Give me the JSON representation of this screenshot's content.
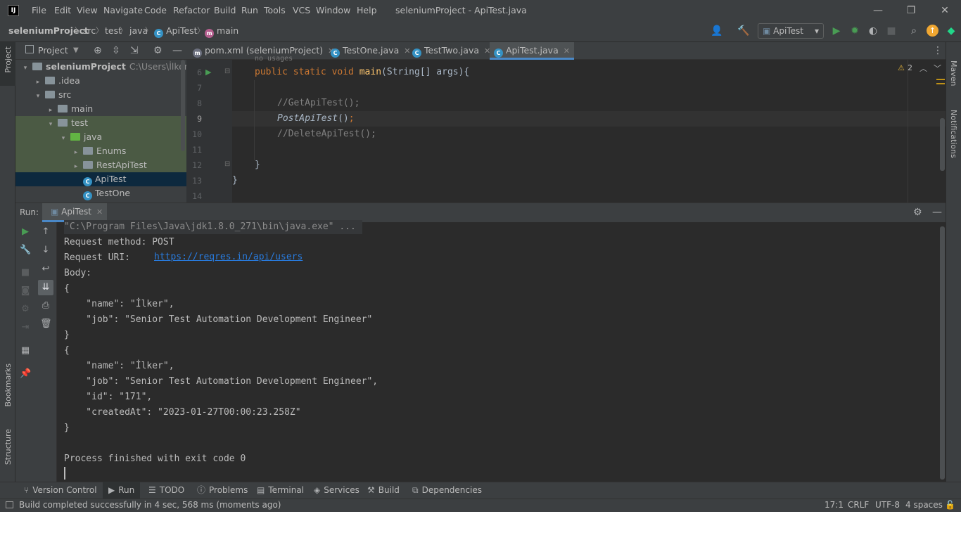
{
  "window": {
    "logo": "IJ",
    "title": "seleniumProject - ApiTest.java",
    "menu": [
      "File",
      "Edit",
      "View",
      "Navigate",
      "Code",
      "Refactor",
      "Build",
      "Run",
      "Tools",
      "VCS",
      "Window",
      "Help"
    ],
    "minimize": "—",
    "restore": "❐",
    "close": "✕"
  },
  "breadcrumb": {
    "project": "seleniumProject",
    "items": [
      "src",
      "test",
      "java"
    ],
    "class": "ApiTest",
    "method": "main"
  },
  "toolbar": {
    "run_config": "ApiTest"
  },
  "left_strip": {
    "project": "Project",
    "bookmarks": "Bookmarks",
    "structure": "Structure"
  },
  "right_strip": {
    "maven": "Maven",
    "notifications": "Notifications"
  },
  "project_panel": {
    "title": "Project",
    "tree": [
      {
        "label": "seleniumProject",
        "path": "C:\\Users\\İlker ESEN\\",
        "indent": 0,
        "arrow": "▾",
        "icon": "folder"
      },
      {
        "label": ".idea",
        "indent": 1,
        "arrow": "▸",
        "icon": "folder"
      },
      {
        "label": "src",
        "indent": 1,
        "arrow": "▾",
        "icon": "folder"
      },
      {
        "label": "main",
        "indent": 2,
        "arrow": "▸",
        "icon": "folder"
      },
      {
        "label": "test",
        "indent": 2,
        "arrow": "▾",
        "icon": "folder"
      },
      {
        "label": "java",
        "indent": 3,
        "arrow": "▾",
        "icon": "green-folder"
      },
      {
        "label": "Enums",
        "indent": 4,
        "arrow": "▸",
        "icon": "package"
      },
      {
        "label": "RestApiTest",
        "indent": 4,
        "arrow": "▸",
        "icon": "package"
      },
      {
        "label": "ApiTest",
        "indent": 4,
        "arrow": "",
        "icon": "class"
      },
      {
        "label": "TestOne",
        "indent": 4,
        "arrow": "",
        "icon": "class"
      }
    ]
  },
  "editor": {
    "tabs": [
      {
        "label": "pom.xml (seleniumProject)",
        "icon": "m",
        "active": false
      },
      {
        "label": "TestOne.java",
        "icon": "c",
        "active": false
      },
      {
        "label": "TestTwo.java",
        "icon": "c",
        "active": false
      },
      {
        "label": "ApiTest.java",
        "icon": "c",
        "active": true
      }
    ],
    "hint_above": "no usages",
    "warning_count": "2",
    "lines": [
      {
        "num": "6",
        "text": "public static void main(String[] args){"
      },
      {
        "num": "7",
        "text": ""
      },
      {
        "num": "8",
        "text": "//GetApiTest();"
      },
      {
        "num": "9",
        "text": "PostApiTest();"
      },
      {
        "num": "10",
        "text": "//DeleteApiTest();"
      },
      {
        "num": "11",
        "text": ""
      },
      {
        "num": "12",
        "text": "}"
      },
      {
        "num": "13",
        "text": "}"
      },
      {
        "num": "14",
        "text": ""
      }
    ]
  },
  "run_panel": {
    "label": "Run:",
    "tab": "ApiTest",
    "console": [
      "\"C:\\Program Files\\Java\\jdk1.8.0_271\\bin\\java.exe\" ...",
      "Request method:\tPOST",
      "Request URI:\t",
      "Body:",
      "{",
      "    \"name\": \"İlker\",",
      "    \"job\": \"Senior Test Automation Development Engineer\"",
      "}",
      "{",
      "    \"name\": \"İlker\",",
      "    \"job\": \"Senior Test Automation Development Engineer\",",
      "    \"id\": \"171\",",
      "    \"createdAt\": \"2023-01-27T00:00:23.258Z\"",
      "}",
      "",
      "Process finished with exit code 0"
    ],
    "request_uri_link": "https://reqres.in/api/users"
  },
  "bottom_tools": [
    "Version Control",
    "Run",
    "TODO",
    "Problems",
    "Terminal",
    "Services",
    "Build",
    "Dependencies"
  ],
  "status_bar": {
    "message": "Build completed successfully in 4 sec, 568 ms (moments ago)",
    "position": "17:1",
    "line_sep": "CRLF",
    "encoding": "UTF-8",
    "indent": "4 spaces"
  },
  "colors": {
    "bg_dark": "#2b2b2b",
    "panel": "#3c3f41",
    "keyword": "#cc7832",
    "function": "#ffc66d",
    "comment": "#808080",
    "link": "#287bde",
    "run_green": "#499c54"
  }
}
